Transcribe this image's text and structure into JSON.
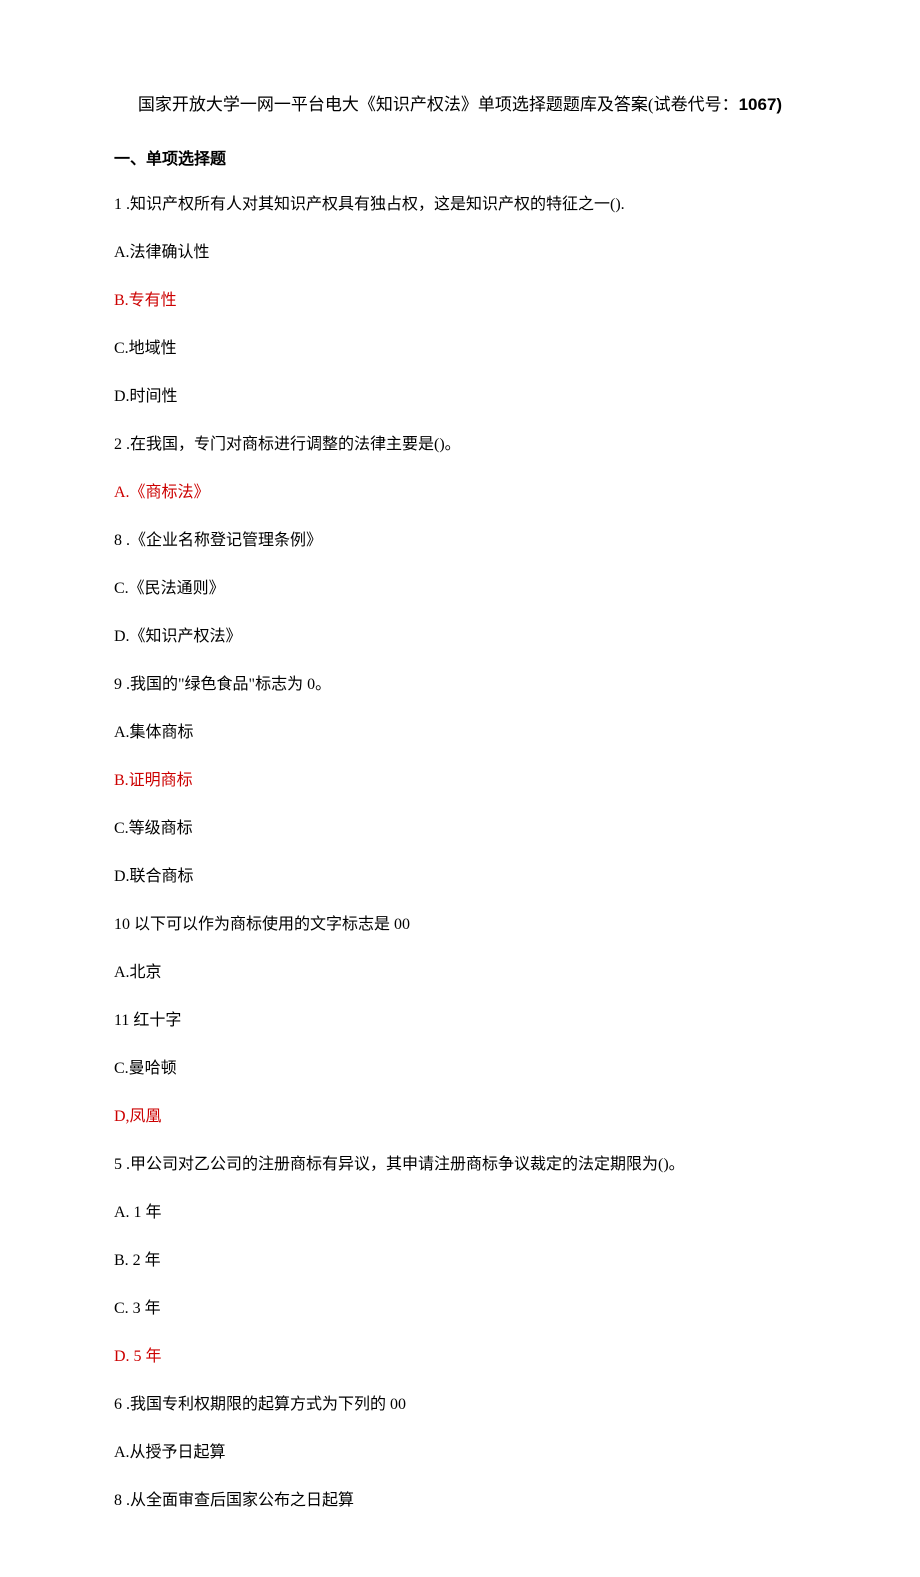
{
  "title_prefix": "国家开放大学一网一平台电大《知识产权法》单项选择题题库及答案(试卷代号：",
  "title_code": "1067)",
  "section_heading": "一、单项选择题",
  "lines": [
    {
      "text": "1 .知识产权所有人对其知识产权具有独占权，这是知识产权的特征之一().",
      "red": false
    },
    {
      "text": "A.法律确认性",
      "red": false
    },
    {
      "text": "B.专有性",
      "red": true
    },
    {
      "text": "C.地域性",
      "red": false
    },
    {
      "text": "D.时间性",
      "red": false
    },
    {
      "text": "2 .在我国，专门对商标进行调整的法律主要是()。",
      "red": false
    },
    {
      "text": "A.《商标法》",
      "red": true
    },
    {
      "text": "8 .《企业名称登记管理条例》",
      "red": false
    },
    {
      "text": "C.《民法通则》",
      "red": false
    },
    {
      "text": "D.《知识产权法》",
      "red": false
    },
    {
      "text": "9 .我国的\"绿色食品\"标志为 0。",
      "red": false
    },
    {
      "text": "A.集体商标",
      "red": false
    },
    {
      "text": "B.证明商标",
      "red": true
    },
    {
      "text": "C.等级商标",
      "red": false
    },
    {
      "text": "D.联合商标",
      "red": false
    },
    {
      "text": "10  以下可以作为商标使用的文字标志是 00",
      "red": false
    },
    {
      "text": "A.北京",
      "red": false
    },
    {
      "text": "11  红十字",
      "red": false
    },
    {
      "text": "C.曼哈顿",
      "red": false
    },
    {
      "text": "D,凤凰",
      "red": true
    },
    {
      "text": "5 .甲公司对乙公司的注册商标有异议，其申请注册商标争议裁定的法定期限为()。",
      "red": false
    },
    {
      "text": "A.  1 年",
      "red": false,
      "boldPrefix": "A."
    },
    {
      "text": "B.  2 年",
      "red": false,
      "boldPrefix": "B."
    },
    {
      "text": "C.  3 年",
      "red": false,
      "boldPrefix": "C."
    },
    {
      "text": "D.  5 年",
      "red": true,
      "boldPrefix": "D."
    },
    {
      "text": "6 .我国专利权期限的起算方式为下列的 00",
      "red": false
    },
    {
      "text": "A.从授予日起算",
      "red": false
    },
    {
      "text": "8 .从全面审查后国家公布之日起算",
      "red": false
    }
  ]
}
